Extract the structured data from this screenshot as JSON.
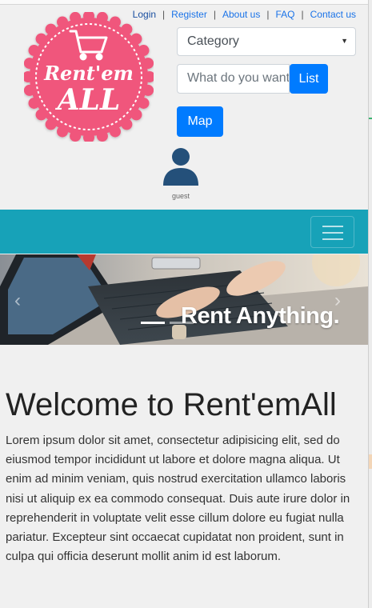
{
  "header": {
    "links": [
      "Login",
      "Register",
      "About us",
      "FAQ",
      "Contact us"
    ],
    "separator": "|"
  },
  "logo": {
    "line1": "Rent'em",
    "line2": "ALL"
  },
  "search": {
    "category_selected": "Category",
    "input_placeholder": "What do you want",
    "list_label": "List",
    "map_label": "Map"
  },
  "user": {
    "name": "guest"
  },
  "carousel": {
    "caption": "Rent Anything.",
    "prev": "‹",
    "next": "›"
  },
  "main": {
    "title": "Welcome to Rent'emAll",
    "body": "Lorem ipsum dolor sit amet, consectetur adipisicing elit, sed do eiusmod tempor incididunt ut labore et dolore magna aliqua. Ut enim ad minim veniam, quis nostrud exercitation ullamco laboris nisi ut aliquip ex ea commodo consequat. Duis aute irure dolor in reprehenderit in voluptate velit esse cillum dolore eu fugiat nulla pariatur. Excepteur sint occaecat cupidatat non proident, sunt in culpa qui officia deserunt mollit anim id est laborum."
  },
  "colors": {
    "accent": "#007bff",
    "navbar": "#17a2b8",
    "logo_pink": "#f0567c"
  }
}
